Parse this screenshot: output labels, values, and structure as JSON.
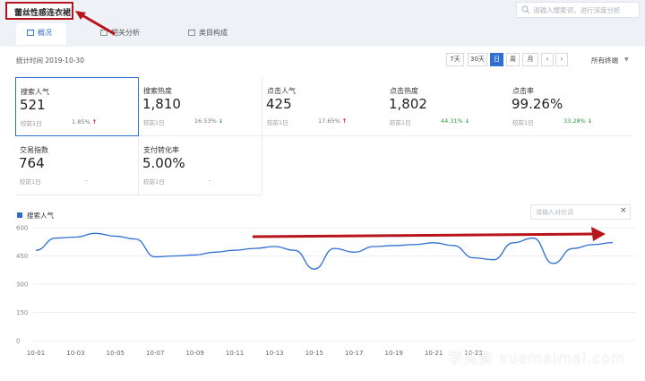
{
  "header": {
    "title": "蕾丝性感连衣裙",
    "search_placeholder": "请输入搜索词，进行深度分析"
  },
  "tabs": [
    {
      "label": "概况",
      "icon": "overview-icon",
      "active": true
    },
    {
      "label": "相关分析",
      "icon": "analysis-icon",
      "active": false
    },
    {
      "label": "类目构成",
      "icon": "category-icon",
      "active": false
    }
  ],
  "toolbar": {
    "stat_time": "统计时间 2019-10-30",
    "ranges": [
      "7天",
      "30天",
      "日",
      "周",
      "月"
    ],
    "active_range": "日",
    "prev": "‹",
    "next": "›",
    "channel": "所有终端"
  },
  "metrics": [
    {
      "label": "搜索人气",
      "value": "521",
      "prev": "较前1日",
      "change": "1.85%",
      "dir": "up"
    },
    {
      "label": "搜索热度",
      "value": "1,810",
      "prev": "较前1日",
      "change": "16.53%",
      "dir": "down"
    },
    {
      "label": "点击人气",
      "value": "425",
      "prev": "较前1日",
      "change": "17.65%",
      "dir": "up"
    },
    {
      "label": "点击热度",
      "value": "1,802",
      "prev": "较前1日",
      "change": "44.31%",
      "dir": "down"
    },
    {
      "label": "点击率",
      "value": "99.26%",
      "prev": "较前1日",
      "change": "33.28%",
      "dir": "down"
    },
    {
      "label": "交易指数",
      "value": "764",
      "prev": "较前1日",
      "change": "-",
      "dir": "none"
    },
    {
      "label": "支付转化率",
      "value": "5.00%",
      "prev": "较前1日",
      "change": "-",
      "dir": "none"
    }
  ],
  "chart_controls": {
    "legend": "搜索人气",
    "compare_placeholder": "请输入对比词",
    "compare_clear": "×"
  },
  "colors": {
    "accent": "#2f6fd1",
    "up": "#e02020",
    "down": "#2a9d3a",
    "annotation": "#b8141c"
  },
  "chart_data": {
    "type": "line",
    "title": "",
    "xlabel": "",
    "ylabel": "",
    "ylim": [
      0,
      600
    ],
    "yticks": [
      0,
      150,
      300,
      450,
      600
    ],
    "x_tick_labels": [
      "10-01",
      "10-03",
      "10-05",
      "10-07",
      "10-09",
      "10-11",
      "10-13",
      "10-15",
      "10-17",
      "10-19",
      "10-21",
      "10-23"
    ],
    "x": [
      "10-01",
      "10-02",
      "10-03",
      "10-04",
      "10-05",
      "10-06",
      "10-07",
      "10-08",
      "10-09",
      "10-10",
      "10-11",
      "10-12",
      "10-13",
      "10-14",
      "10-15",
      "10-16",
      "10-17",
      "10-18",
      "10-19",
      "10-20",
      "10-21",
      "10-22",
      "10-23",
      "10-24",
      "10-25",
      "10-26",
      "10-27",
      "10-28",
      "10-29",
      "10-30"
    ],
    "series": [
      {
        "name": "搜索人气",
        "values": [
          480,
          545,
          550,
          570,
          555,
          540,
          445,
          450,
          455,
          470,
          480,
          490,
          500,
          480,
          380,
          490,
          470,
          500,
          505,
          510,
          520,
          505,
          440,
          430,
          520,
          545,
          410,
          490,
          510,
          521
        ]
      }
    ],
    "grid": true,
    "legend_position": "top-left"
  },
  "watermark": "学买卖 xuemaimai.com"
}
